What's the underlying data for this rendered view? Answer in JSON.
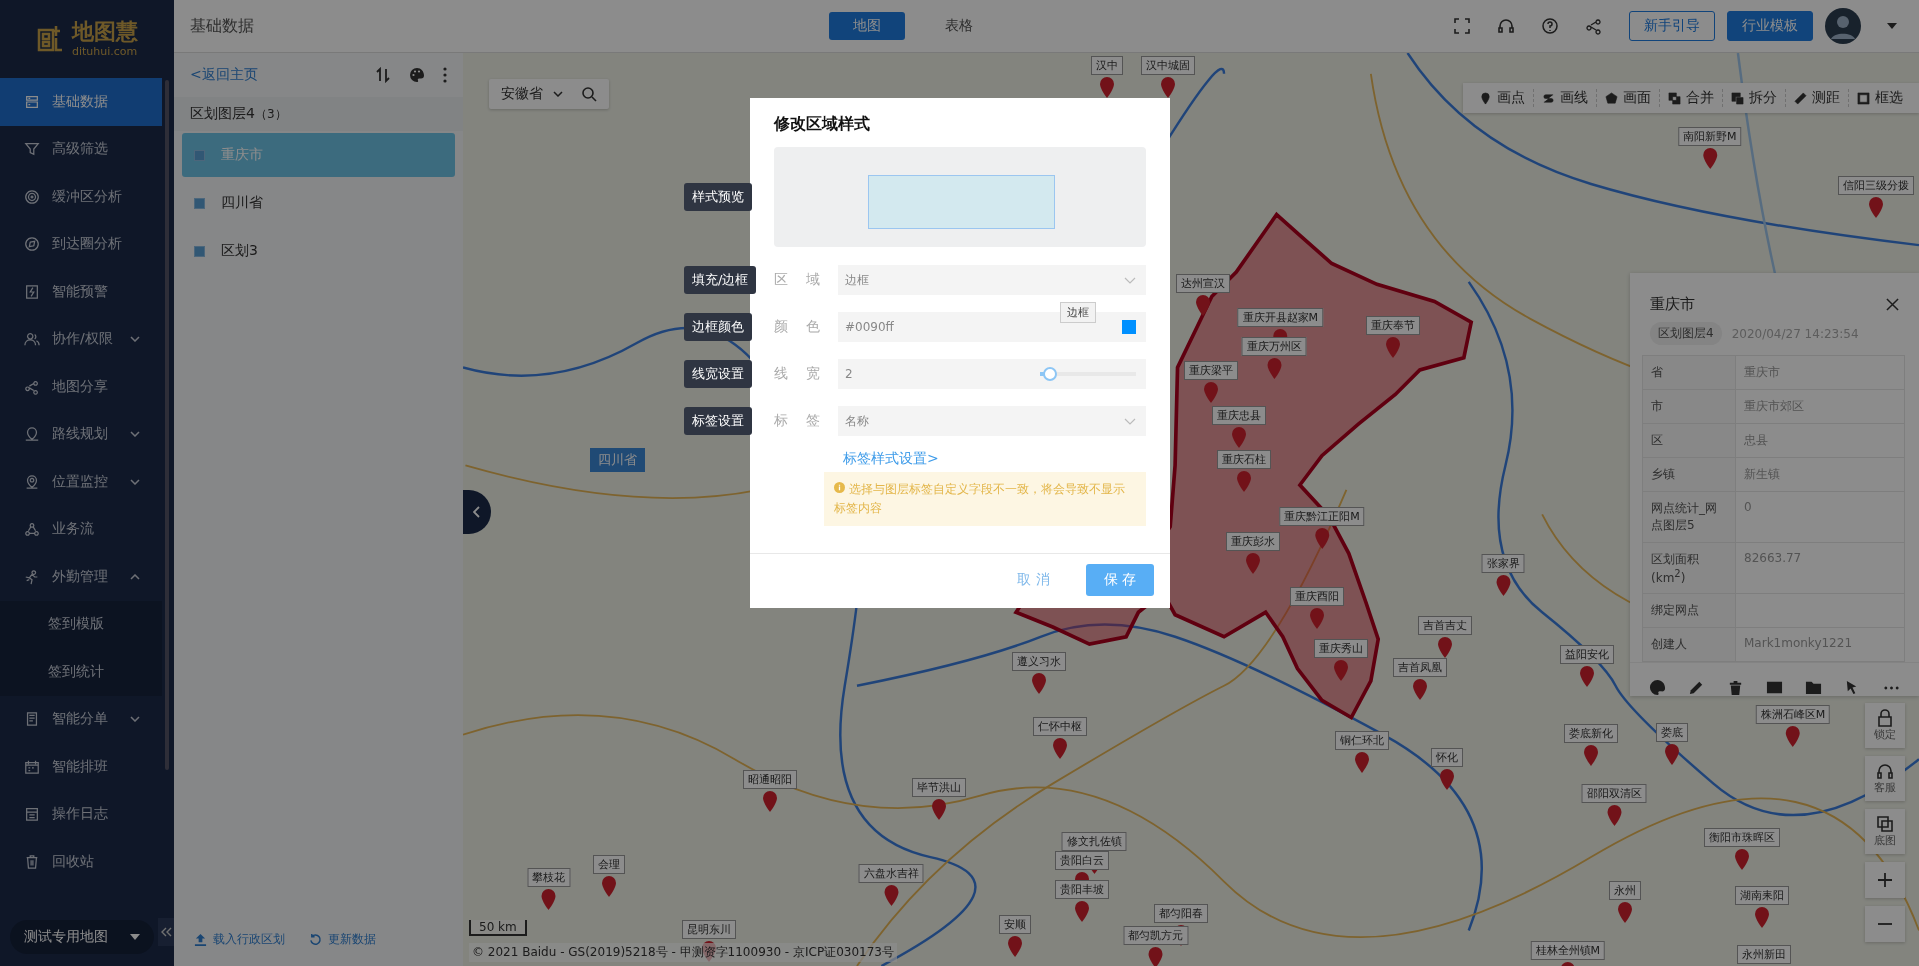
{
  "logo": {
    "name": "地图慧",
    "domain": "dituhui.com"
  },
  "nav": [
    {
      "label": "基础数据",
      "kind": "link",
      "selected": true
    },
    {
      "label": "高级筛选",
      "kind": "link",
      "selected": false
    },
    {
      "label": "缓冲区分析",
      "kind": "link",
      "selected": false
    },
    {
      "label": "到达圈分析",
      "kind": "link",
      "selected": false
    },
    {
      "label": "智能预警",
      "kind": "link",
      "selected": false
    },
    {
      "label": "协作/权限",
      "kind": "group",
      "selected": false,
      "expanded": false
    },
    {
      "label": "地图分享",
      "kind": "link",
      "selected": false
    },
    {
      "label": "路线规划",
      "kind": "group",
      "selected": false,
      "expanded": false
    },
    {
      "label": "位置监控",
      "kind": "group",
      "selected": false,
      "expanded": false
    },
    {
      "label": "业务流",
      "kind": "link",
      "selected": false
    },
    {
      "label": "外勤管理",
      "kind": "group",
      "selected": false,
      "expanded": true,
      "children": [
        {
          "label": "签到模版",
          "selected": false
        },
        {
          "label": "签到统计",
          "selected": false
        }
      ]
    },
    {
      "label": "智能分单",
      "kind": "group",
      "selected": false,
      "expanded": false
    },
    {
      "label": "智能排班",
      "kind": "link",
      "selected": false
    },
    {
      "label": "操作日志",
      "kind": "link",
      "selected": false
    },
    {
      "label": "回收站",
      "kind": "link",
      "selected": false
    }
  ],
  "map_selector": {
    "value": "测试专用地图"
  },
  "header": {
    "title": "基础数据",
    "tabs": [
      {
        "label": "地图",
        "selected": true
      },
      {
        "label": "表格",
        "selected": false
      }
    ],
    "buttons": [
      {
        "label": "新手引导",
        "kind": "outline"
      },
      {
        "label": "行业模板",
        "kind": "primary"
      }
    ]
  },
  "layer_panel": {
    "back": "<返回主页",
    "group": {
      "name": "区划图层4",
      "count": "（3）"
    },
    "items": [
      {
        "label": "重庆市",
        "selected": true
      },
      {
        "label": "四川省",
        "selected": false
      },
      {
        "label": "区划3",
        "selected": false
      }
    ],
    "actions": [
      "载入行政区划",
      "更新数据"
    ]
  },
  "map": {
    "province_select": "安徽省",
    "tools": [
      "画点",
      "画线",
      "画面",
      "合并",
      "拆分",
      "测距",
      "框选"
    ],
    "region_label": "四川省",
    "markers": [
      "汉中",
      "汉中城固",
      "南阳新野M",
      "信阳三级分拨",
      "达州宣汉",
      "重庆开县赵家M",
      "重庆奉节",
      "重庆万州区",
      "重庆梁平",
      "重庆忠县",
      "重庆石柱",
      "重庆黔江正阳M",
      "重庆彭水",
      "重庆酉阳",
      "重庆秀山",
      "张家界",
      "吉首吉丈",
      "吉首凤凰",
      "益阳安化",
      "遵义习水",
      "仁怀中枢",
      "铜仁环北",
      "怀化",
      "娄底新化",
      "娄底",
      "株洲石峰区M",
      "邵阳双清区",
      "衡阳市珠晖区",
      "永州",
      "湖南耒阳",
      "桂林全州镇M",
      "永州新田",
      "昭通昭阳",
      "毕节洪山",
      "修文扎佐镇",
      "贵阳白云",
      "六盘水吉祥",
      "贵阳丰坡",
      "安顺",
      "都匀阳春",
      "都匀凯方元",
      "会理",
      "攀枝花",
      "昆明东川"
    ],
    "controls": [
      "锁定",
      "客服",
      "底图"
    ],
    "scale": "50 km",
    "copyright": "© 2021 Baidu - GS(2019)5218号 - 甲测资字1100930 - 京ICP证030173号"
  },
  "info_panel": {
    "title": "重庆市",
    "tag": "区划图层4",
    "time": "2020/04/27 14:23:54",
    "rows": [
      {
        "key": "省",
        "value": "重庆市"
      },
      {
        "key": "市",
        "value": "重庆市郊区"
      },
      {
        "key": "区",
        "value": "忠县"
      },
      {
        "key": "乡镇",
        "value": "新生镇"
      },
      {
        "key": "网点统计_网点图层5",
        "value": "0"
      },
      {
        "key": "区划面积(km$^{2}$)",
        "value": "82663.77"
      },
      {
        "key": "绑定网点"
      },
      {
        "key": "创建人",
        "value": "Mark1monky1221"
      }
    ]
  },
  "dialog": {
    "title": "修改区域样式",
    "preview_callout": "样式预览",
    "fields": [
      {
        "label": "区 域",
        "kind": "select",
        "value": "边框",
        "callout": "填充/边框"
      },
      {
        "label": "颜 色",
        "kind": "color",
        "value": "#0090ff",
        "callout": "边框颜色",
        "tooltip": "边框"
      },
      {
        "label": "线 宽",
        "kind": "slider",
        "value": "2",
        "level": 0.04,
        "callout": "线宽设置"
      },
      {
        "label": "标 签",
        "kind": "select",
        "value": "名称",
        "callout": "标签设置"
      }
    ],
    "link": "标签样式设置>",
    "warning": "选择与图层标签自定义字段不一致，将会导致不显示标签内容",
    "buttons": [
      {
        "label": "取 消",
        "kind": "text"
      },
      {
        "label": "保 存",
        "kind": "primary"
      }
    ]
  }
}
